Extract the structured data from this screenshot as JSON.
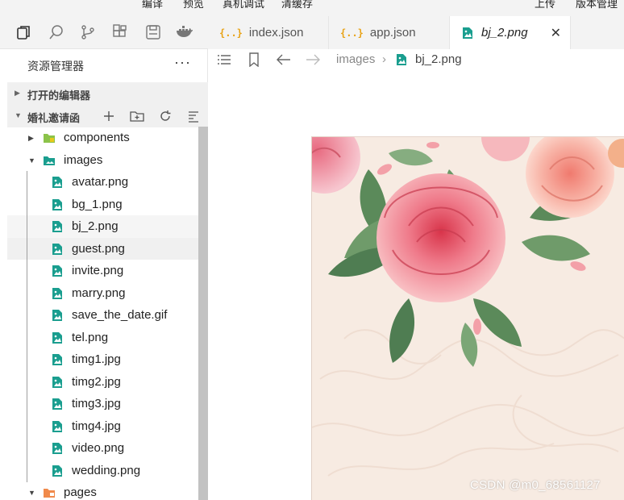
{
  "menu": {
    "items": [
      "编译",
      "预览",
      "真机调试",
      "清缓存",
      "上传",
      "版本管理"
    ]
  },
  "activity_bar": {
    "icons": [
      "files-icon",
      "search-icon",
      "source-control-icon",
      "extensions-icon",
      "save-icon",
      "docker-icon"
    ]
  },
  "tabs": [
    {
      "label": "index.json",
      "icon": "{..}",
      "active": false
    },
    {
      "label": "app.json",
      "icon": "{..}",
      "active": false
    },
    {
      "label": "bj_2.png",
      "icon": "image-file-icon",
      "active": true
    }
  ],
  "breadcrumb": {
    "folder": "images",
    "file": "bj_2.png"
  },
  "explorer": {
    "title": "资源管理器",
    "more": "···",
    "open_editors": "打开的编辑器",
    "project": "婚礼邀请函"
  },
  "tree": {
    "folders": {
      "components": "components",
      "images": "images",
      "pages": "pages"
    },
    "files": [
      "avatar.png",
      "bg_1.png",
      "bj_2.png",
      "guest.png",
      "invite.png",
      "marry.png",
      "save_the_date.gif",
      "tel.png",
      "timg1.jpg",
      "timg2.jpg",
      "timg3.jpg",
      "timg4.jpg",
      "video.png",
      "wedding.png"
    ]
  },
  "watermark": "CSDN @m0_68561127",
  "colors": {
    "accent_teal": "#1a9e8f",
    "json_icon": "#e8a317",
    "folder_green": "#8bc34a",
    "folder_orange": "#f08a4b"
  }
}
